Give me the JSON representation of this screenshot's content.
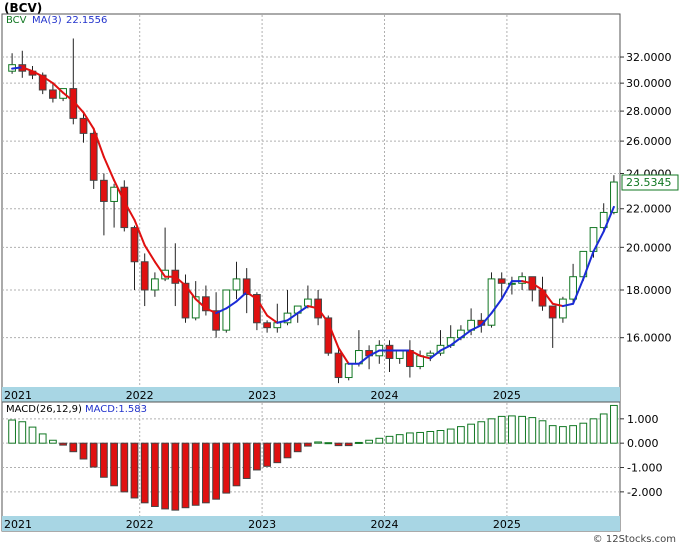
{
  "title": "(BCV)",
  "watermark": "© 12Stocks.com",
  "price_panel": {
    "symbol_label": "BCV",
    "ma_label": "MA(3)",
    "ma_value": "22.1556",
    "last_price": "23.5345"
  },
  "macd_panel": {
    "label": "MACD(26,12,9)",
    "value_label": "MACD:1.583"
  },
  "colors": {
    "up_candle": "#117722",
    "down_candle": "#e01010",
    "ma_up": "#1a2bd6",
    "ma_down": "#e01010",
    "axis_band": "#a8d6e4",
    "grid": "#b0b0b0"
  },
  "chart_data": [
    {
      "type": "candlestick",
      "scale": "log",
      "ylim": [
        14.2,
        35.5
      ],
      "yticks": [
        "16.0000",
        "18.0000",
        "20.0000",
        "22.0000",
        "24.0000",
        "26.0000",
        "28.0000",
        "30.0000",
        "32.0000"
      ],
      "x_labels": [
        "2021",
        "2022",
        "2023",
        "2024",
        "2025"
      ],
      "ohlc": [
        [
          30.9,
          32.3,
          31.4,
          30.7
        ],
        [
          31.4,
          32.5,
          30.9,
          30.4
        ],
        [
          30.9,
          31.3,
          30.6,
          30.3
        ],
        [
          30.6,
          30.8,
          29.5,
          29.2
        ],
        [
          29.5,
          30.0,
          28.9,
          28.6
        ],
        [
          28.9,
          29.4,
          29.6,
          28.7
        ],
        [
          29.6,
          33.5,
          27.5,
          27.1
        ],
        [
          27.5,
          27.8,
          26.5,
          25.9
        ],
        [
          26.5,
          26.8,
          23.6,
          23.1
        ],
        [
          23.6,
          24.0,
          22.4,
          20.6
        ],
        [
          22.4,
          23.4,
          23.2,
          21.0
        ],
        [
          23.2,
          23.6,
          21.0,
          20.8
        ],
        [
          21.0,
          21.1,
          19.3,
          18.0
        ],
        [
          19.3,
          19.7,
          18.0,
          17.3
        ],
        [
          18.0,
          18.8,
          18.5,
          17.7
        ],
        [
          18.5,
          21.0,
          18.9,
          18.4
        ],
        [
          18.9,
          20.2,
          18.3,
          17.3
        ],
        [
          18.3,
          18.7,
          16.8,
          16.6
        ],
        [
          16.8,
          18.4,
          17.7,
          16.7
        ],
        [
          17.7,
          18.2,
          17.1,
          16.9
        ],
        [
          17.1,
          17.9,
          16.3,
          16.0
        ],
        [
          16.3,
          18.0,
          18.0,
          16.2
        ],
        [
          18.0,
          19.3,
          18.5,
          17.6
        ],
        [
          18.5,
          19.0,
          17.8,
          17.0
        ],
        [
          17.8,
          17.9,
          16.6,
          16.3
        ],
        [
          16.6,
          16.7,
          16.4,
          16.2
        ],
        [
          16.4,
          17.4,
          16.6,
          16.2
        ],
        [
          16.6,
          18.0,
          17.0,
          16.5
        ],
        [
          17.0,
          17.2,
          17.3,
          16.6
        ],
        [
          17.3,
          18.2,
          17.6,
          17.2
        ],
        [
          17.6,
          18.0,
          16.8,
          16.5
        ],
        [
          16.8,
          16.9,
          15.4,
          15.3
        ],
        [
          15.4,
          15.6,
          14.5,
          14.3
        ],
        [
          14.5,
          15.0,
          15.0,
          14.4
        ],
        [
          15.0,
          16.3,
          15.5,
          14.9
        ],
        [
          15.5,
          15.7,
          15.3,
          14.8
        ],
        [
          15.3,
          15.9,
          15.7,
          15.0
        ],
        [
          15.7,
          15.9,
          15.2,
          14.7
        ],
        [
          15.2,
          15.5,
          15.5,
          15.0
        ],
        [
          15.5,
          15.9,
          14.9,
          14.5
        ],
        [
          14.9,
          15.5,
          15.3,
          14.8
        ],
        [
          15.3,
          15.5,
          15.4,
          15.1
        ],
        [
          15.4,
          16.3,
          15.7,
          15.3
        ],
        [
          15.7,
          16.5,
          16.0,
          15.6
        ],
        [
          16.0,
          16.5,
          16.3,
          15.9
        ],
        [
          16.3,
          17.2,
          16.7,
          16.1
        ],
        [
          16.7,
          17.0,
          16.5,
          16.2
        ],
        [
          16.5,
          18.8,
          18.5,
          16.4
        ],
        [
          18.5,
          18.8,
          18.3,
          17.6
        ],
        [
          18.3,
          18.6,
          18.3,
          17.8
        ],
        [
          18.3,
          18.8,
          18.6,
          18.0
        ],
        [
          18.6,
          18.6,
          18.0,
          17.5
        ],
        [
          18.0,
          18.6,
          17.3,
          17.1
        ],
        [
          17.3,
          17.3,
          16.8,
          15.6
        ],
        [
          16.8,
          17.7,
          17.6,
          16.6
        ],
        [
          17.6,
          19.2,
          18.6,
          17.4
        ],
        [
          18.6,
          19.8,
          19.8,
          18.4
        ],
        [
          19.8,
          21.0,
          21.0,
          19.5
        ],
        [
          21.0,
          22.3,
          21.8,
          20.8
        ],
        [
          21.8,
          23.9,
          23.5,
          21.7
        ]
      ],
      "ma3": [
        31.1,
        31.2,
        30.9,
        30.5,
        30.0,
        29.3,
        28.7,
        27.9,
        26.8,
        25.0,
        23.6,
        22.4,
        21.4,
        20.1,
        19.3,
        18.6,
        18.6,
        18.2,
        17.6,
        17.2,
        17.0,
        17.2,
        17.5,
        17.9,
        17.6,
        16.9,
        16.6,
        16.7,
        17.0,
        17.3,
        17.2,
        16.6,
        15.6,
        15.0,
        15.0,
        15.3,
        15.5,
        15.5,
        15.5,
        15.5,
        15.3,
        15.2,
        15.5,
        15.7,
        16.0,
        16.3,
        16.5,
        17.0,
        17.6,
        18.4,
        18.4,
        18.3,
        18.0,
        17.4,
        17.3,
        17.4,
        18.5,
        19.8,
        20.8,
        22.1
      ],
      "ma_direction": [
        "up",
        "up",
        "down",
        "down",
        "down",
        "down",
        "down",
        "down",
        "down",
        "down",
        "down",
        "down",
        "down",
        "down",
        "down",
        "down",
        "down",
        "down",
        "down",
        "down",
        "down",
        "up",
        "up",
        "up",
        "down",
        "down",
        "down",
        "up",
        "up",
        "up",
        "down",
        "down",
        "down",
        "down",
        "up",
        "up",
        "up",
        "up",
        "up",
        "up",
        "down",
        "down",
        "up",
        "up",
        "up",
        "up",
        "up",
        "up",
        "up",
        "up",
        "up",
        "down",
        "down",
        "down",
        "down",
        "up",
        "up",
        "up",
        "up",
        "up"
      ]
    },
    {
      "type": "bar",
      "name": "MACD",
      "ylim": [
        -2.95,
        1.65
      ],
      "yticks": [
        "1.000",
        "0.000",
        "-1.000",
        "-2.000"
      ],
      "x_labels": [
        "2021",
        "2022",
        "2023",
        "2024",
        "2025"
      ],
      "values": [
        0.95,
        0.88,
        0.66,
        0.38,
        0.12,
        -0.08,
        -0.35,
        -0.65,
        -0.98,
        -1.4,
        -1.75,
        -2.0,
        -2.25,
        -2.45,
        -2.6,
        -2.7,
        -2.75,
        -2.65,
        -2.55,
        -2.45,
        -2.3,
        -2.05,
        -1.75,
        -1.45,
        -1.1,
        -0.95,
        -0.8,
        -0.6,
        -0.35,
        -0.12,
        0.05,
        0.02,
        -0.1,
        -0.1,
        0.03,
        0.12,
        0.2,
        0.28,
        0.35,
        0.42,
        0.44,
        0.48,
        0.52,
        0.58,
        0.68,
        0.78,
        0.88,
        1.0,
        1.1,
        1.12,
        1.1,
        1.05,
        0.92,
        0.72,
        0.68,
        0.72,
        0.82,
        1.0,
        1.2,
        1.55
      ]
    }
  ]
}
